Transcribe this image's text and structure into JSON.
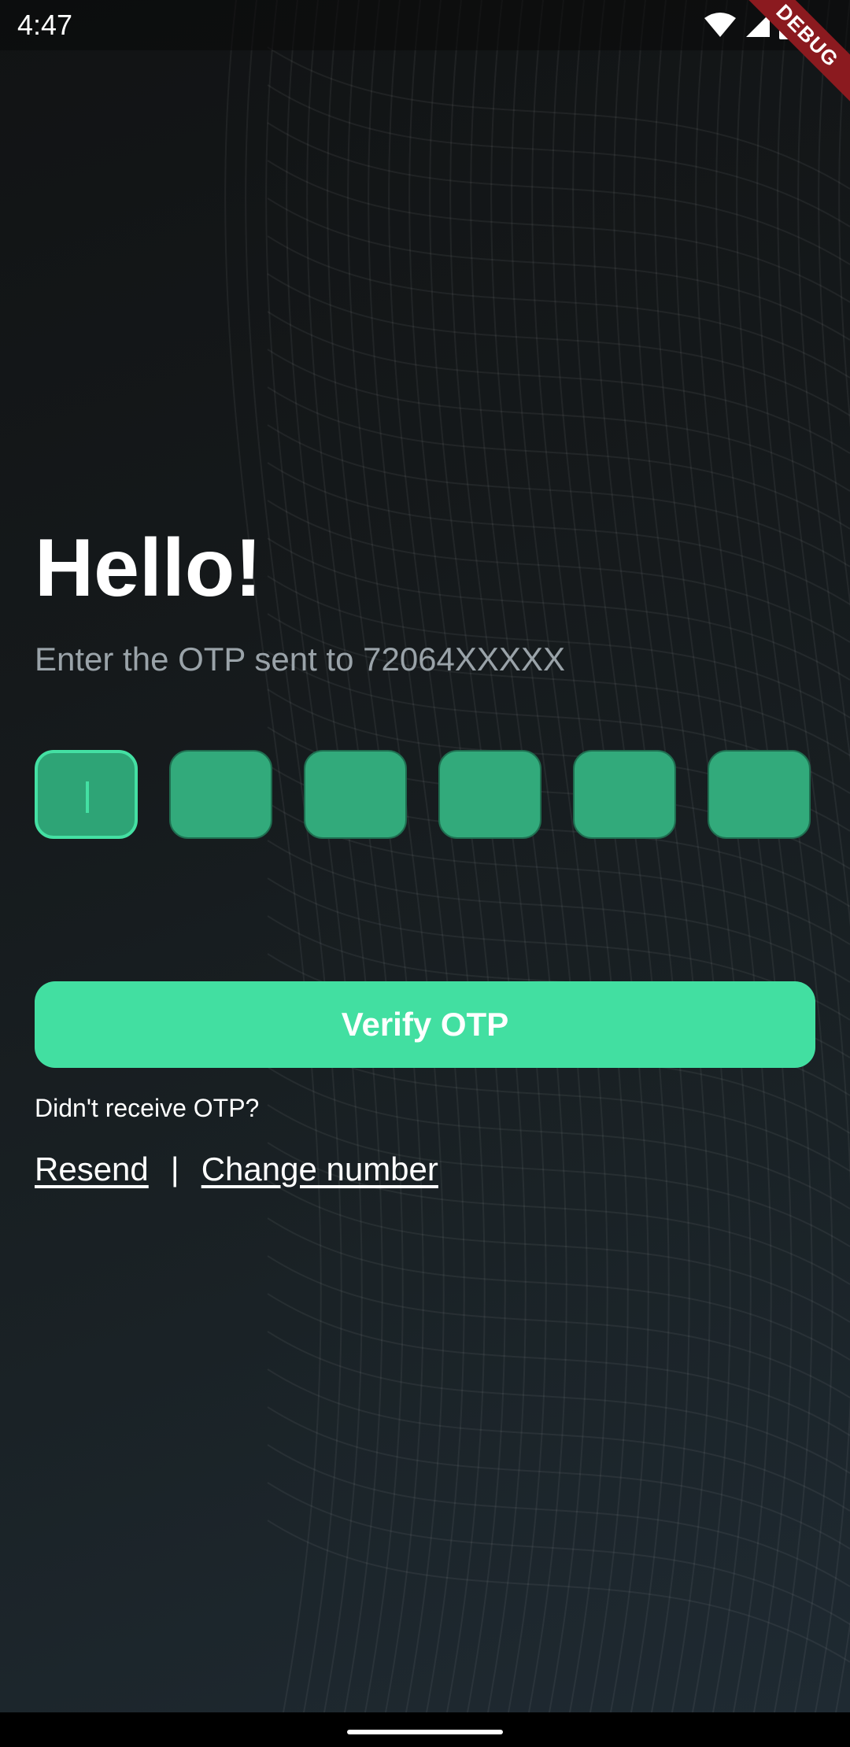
{
  "status_bar": {
    "time": "4:47",
    "icons": [
      "wifi-icon",
      "signal-icon",
      "battery-icon"
    ],
    "debug_label": "DEBUG"
  },
  "main": {
    "greeting": "Hello!",
    "subtitle": "Enter the OTP sent to 72064XXXXX",
    "otp_digits": [
      "",
      "",
      "",
      "",
      "",
      ""
    ],
    "verify_label": "Verify OTP",
    "not_received": "Didn't receive OTP?",
    "resend_label": "Resend",
    "separator": "|",
    "change_number_label": "Change number"
  },
  "colors": {
    "accent": "#42dfa1",
    "otp_box": "#32aa7b",
    "background": "#15191b",
    "debug_ribbon": "#8b1a1f"
  }
}
